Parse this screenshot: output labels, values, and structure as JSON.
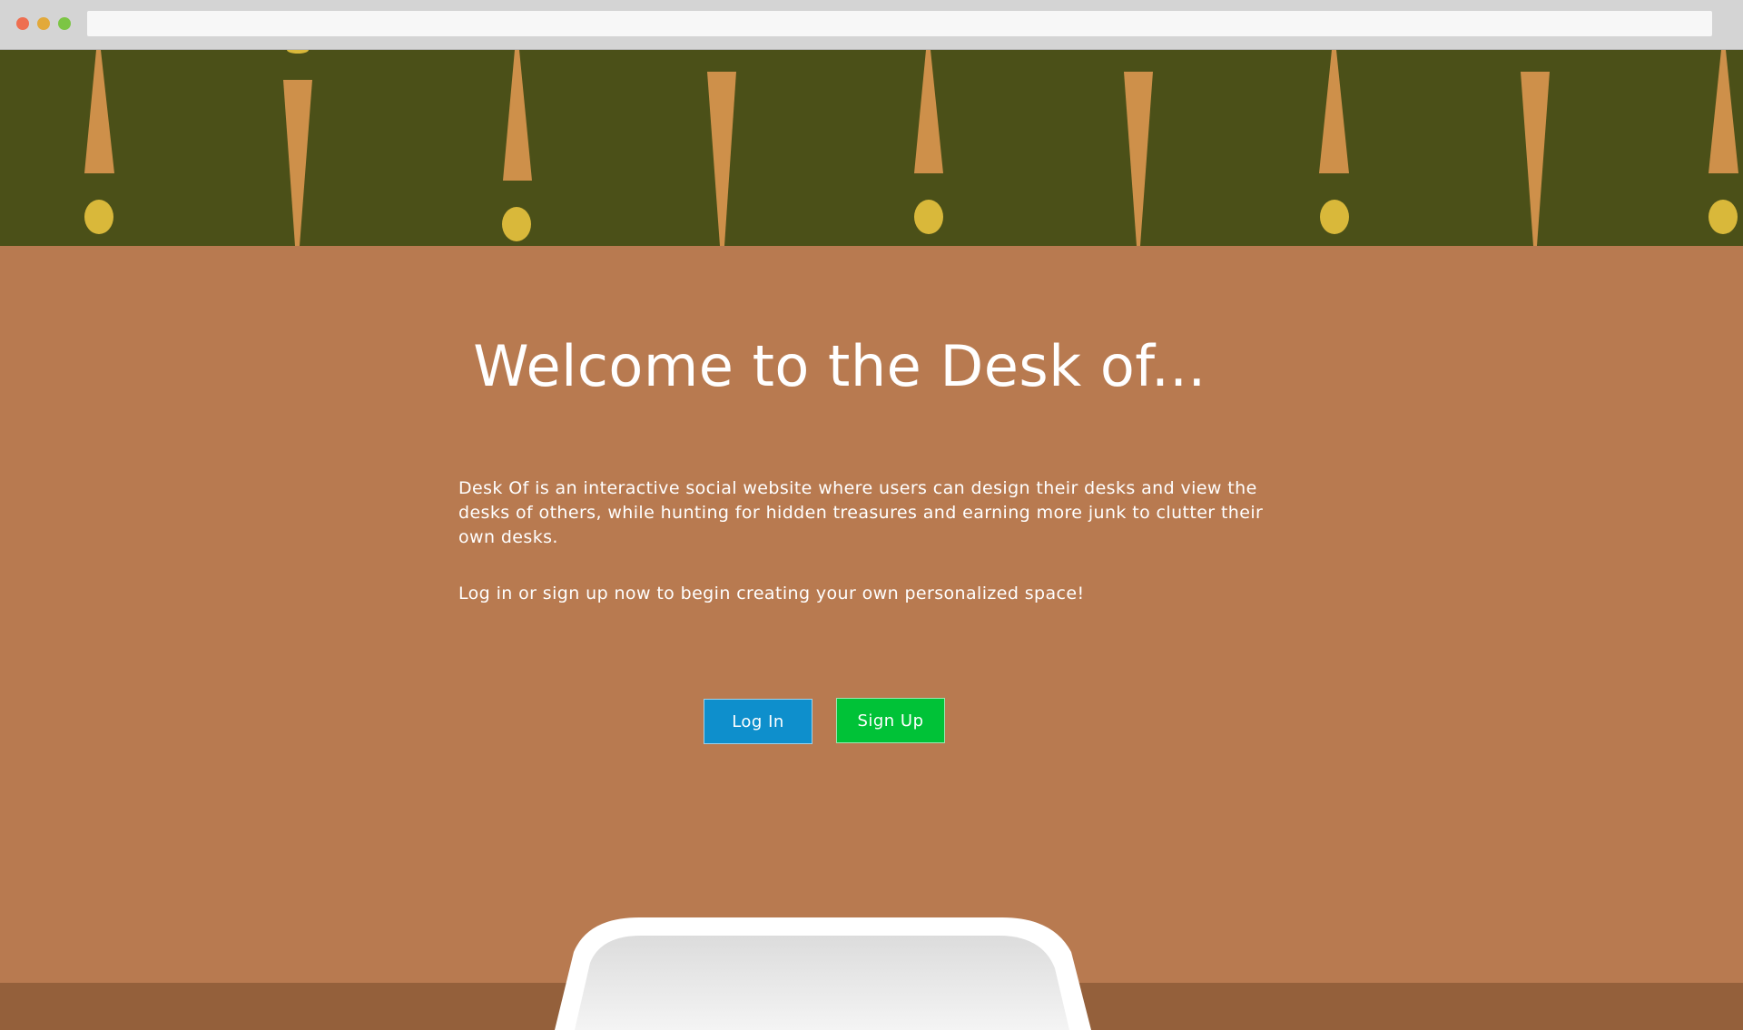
{
  "browser": {
    "address_value": "",
    "address_placeholder": ""
  },
  "colors": {
    "wall_top": "#4b5018",
    "wall_main": "#b87a50",
    "desk_strip": "#94603b",
    "lamp_shade": "#ce904a",
    "lamp_bulb": "#d9b83a",
    "login_button": "#0e8fcc",
    "signup_button": "#00c237"
  },
  "hero": {
    "title": "Welcome to the Desk of...",
    "description": "Desk Of is an interactive social website where users can design their desks and view the desks of others, while hunting for hidden treasures and earning more junk to clutter their own desks.",
    "cta": "Log in or sign up now to begin creating your own personalized space!"
  },
  "buttons": {
    "login_label": "Log In",
    "signup_label": "Sign Up"
  },
  "icons": {
    "lamp": "hanging-lamp-icon",
    "chair": "chair-back-icon"
  }
}
